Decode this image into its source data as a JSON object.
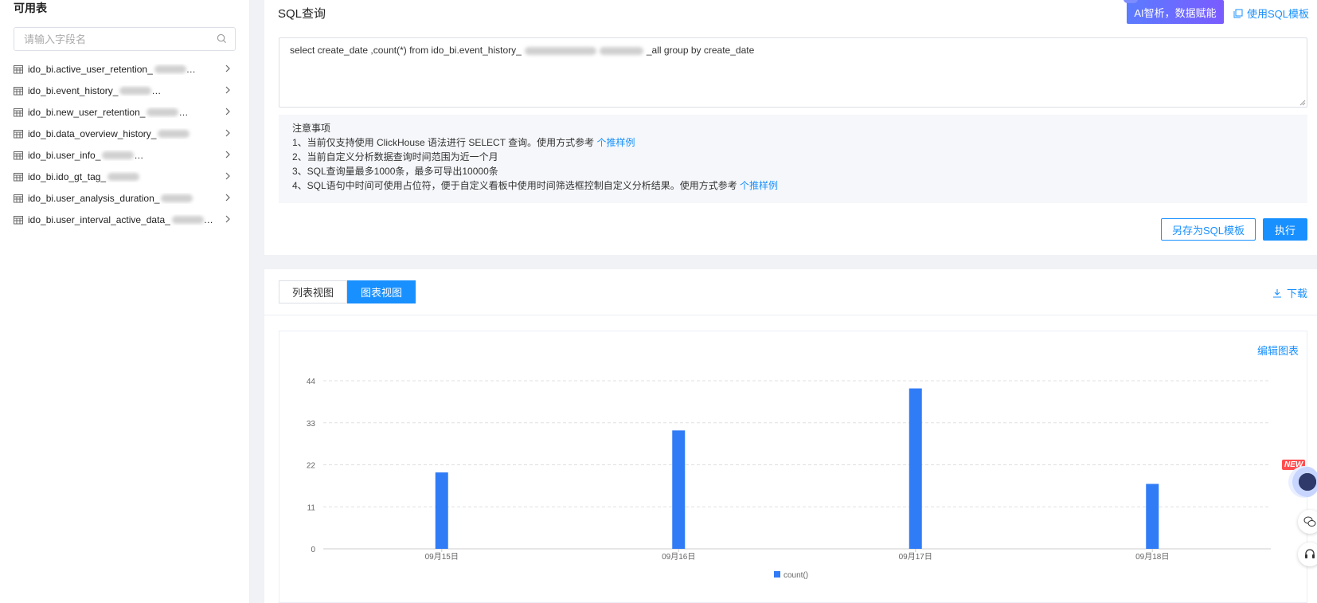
{
  "sidebar": {
    "title": "可用表",
    "search_placeholder": "请输入字段名",
    "tables": [
      {
        "prefix": "ido_bi.active_user_retention_",
        "tail": "…"
      },
      {
        "prefix": "ido_bi.event_history_",
        "tail": "…"
      },
      {
        "prefix": "ido_bi.new_user_retention_",
        "tail": "…"
      },
      {
        "prefix": "ido_bi.data_overview_history_",
        "tail": ""
      },
      {
        "prefix": "ido_bi.user_info_",
        "tail": "…"
      },
      {
        "prefix": "ido_bi.ido_gt_tag_",
        "tail": ""
      },
      {
        "prefix": "ido_bi.user_analysis_duration_",
        "tail": ""
      },
      {
        "prefix": "ido_bi.user_interval_active_data_",
        "tail": "…"
      }
    ]
  },
  "sql_panel": {
    "title": "SQL查询",
    "ai_button": "AI智析，数据赋能",
    "template_link": "使用SQL模板",
    "query_prefix": "select create_date ,count(*) from ido_bi.event_history_",
    "query_suffix": "_all group by create_date",
    "notice": {
      "heading": "注意事项",
      "line1": "1、当前仅支持使用 ClickHouse 语法进行 SELECT 查询。使用方式参考 ",
      "line1_link": "个推样例",
      "line2": "2、当前自定义分析数据查询时间范围为近一个月",
      "line3": "3、SQL查询量最多1000条，最多可导出10000条",
      "line4": "4、SQL语句中时间可使用占位符，便于自定义看板中使用时间筛选框控制自定义分析结果。使用方式参考 ",
      "line4_link": "个推样例"
    },
    "save_button": "另存为SQL模板",
    "run_button": "执行"
  },
  "result_panel": {
    "tab_list": "列表视图",
    "tab_chart": "图表视图",
    "download": "下载",
    "edit_chart": "编辑图表"
  },
  "floating": {
    "new_badge": "NEW"
  },
  "colors": {
    "accent": "#1890ff",
    "bar": "#2f7cf6"
  },
  "chart_data": {
    "type": "bar",
    "categories": [
      "09月15日",
      "09月16日",
      "09月17日",
      "09月18日"
    ],
    "series": [
      {
        "name": "count()",
        "values": [
          20,
          31,
          42,
          17
        ]
      }
    ],
    "yticks": [
      0,
      11,
      22,
      33,
      44
    ],
    "ylim": [
      0,
      44
    ],
    "grid": true,
    "legend": "bottom-center"
  }
}
